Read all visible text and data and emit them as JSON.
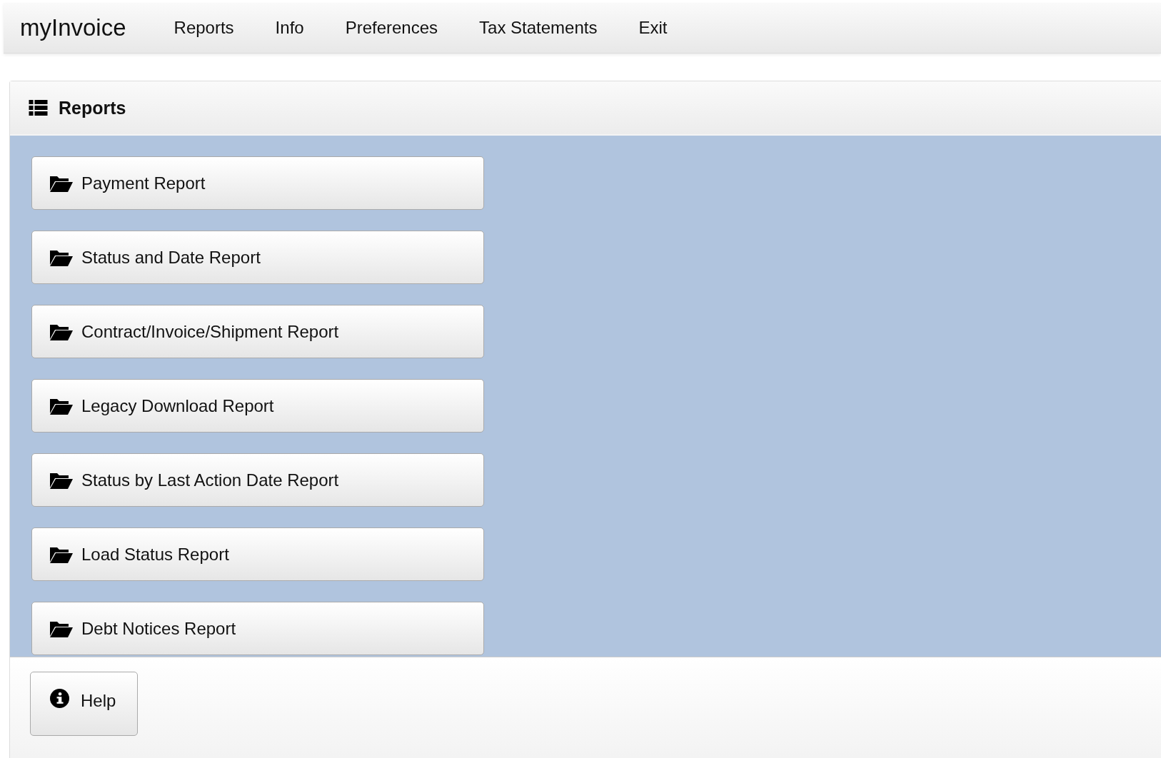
{
  "navbar": {
    "brand": "myInvoice",
    "items": [
      "Reports",
      "Info",
      "Preferences",
      "Tax Statements",
      "Exit"
    ]
  },
  "panel": {
    "title": "Reports",
    "buttons": [
      "Payment Report",
      "Status and Date Report",
      "Contract/Invoice/Shipment Report",
      "Legacy Download Report",
      "Status by Last Action Date Report",
      "Load Status Report",
      "Debt Notices Report"
    ],
    "footer_button": "Help"
  }
}
